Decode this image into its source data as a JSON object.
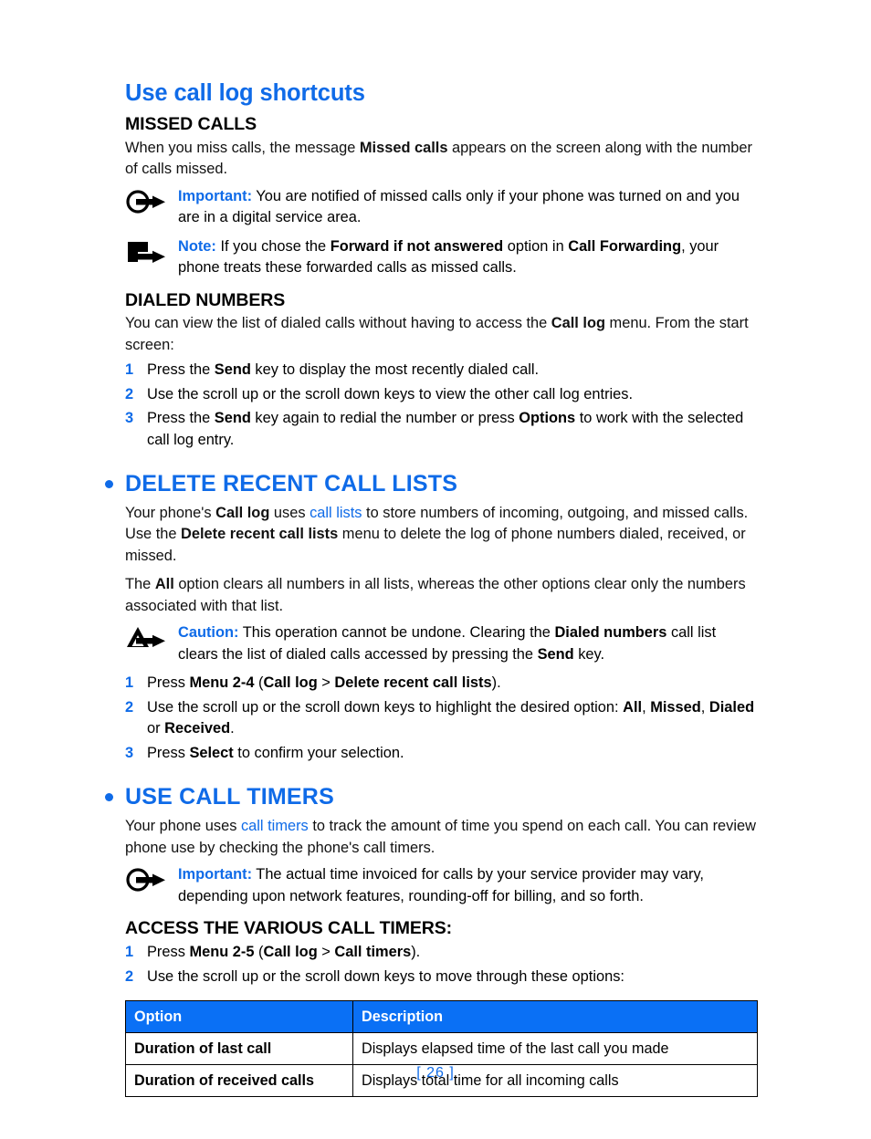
{
  "page": {
    "number_label": "[ 26 ]",
    "accent_color": "#0F6BE8",
    "table_header_color": "#0A70F5"
  },
  "topic": {
    "title": "Use call log shortcuts",
    "missed_calls": {
      "heading": "MISSED CALLS",
      "paragraph_1": "When you miss calls, the message ",
      "paragraph_1_bold": "Missed calls",
      "paragraph_1_end": " appears on the screen along with the number of calls missed.",
      "important": {
        "icon": "important-icon",
        "label": "Important:",
        "text": " You are notified of missed calls only if your phone was turned on and you are in a digital service area."
      },
      "note": {
        "icon": "note-icon",
        "label": "Note:",
        "text_1": " If you chose the ",
        "bold_1": "Forward if not answered",
        "text_2": " option in ",
        "bold_2": "Call Forwarding",
        "text_3": ", your phone treats these forwarded calls as missed calls."
      }
    },
    "dialed_numbers": {
      "heading": "DIALED NUMBERS",
      "intro_1": "You can view the list of dialed calls without having to access the ",
      "intro_bold": "Call log",
      "intro_2": " menu. From the start screen:",
      "steps": [
        {
          "num": "1",
          "text_1": "Press the ",
          "bold_1": "Send",
          "text_2": " key to display the most recently dialed call."
        },
        {
          "num": "2",
          "text_1": "Use the scroll up or the scroll down keys to view the other call log entries.",
          "bold_1": "",
          "text_2": ""
        },
        {
          "num": "3",
          "text_1": "Press the ",
          "bold_1": "Send",
          "text_2": " key again to redial the number or press ",
          "bold_2": "Options",
          "text_3": " to work with the selected call log entry."
        }
      ]
    }
  },
  "delete_recent_call_lists": {
    "title": "DELETE RECENT CALL LISTS",
    "bullet": "section-bullet",
    "p1_a": "Your phone's ",
    "p1_bold_1": "Call log",
    "p1_b": " uses ",
    "p1_blue": "call lists",
    "p1_c": " to store numbers of incoming, outgoing, and missed calls. Use the ",
    "p1_bold_2": "Delete recent call lists",
    "p1_d": " menu to delete the log of phone numbers dialed, received, or missed.",
    "p2_a": "The ",
    "p2_bold": "All",
    "p2_b": " option clears all numbers in all lists, whereas the other options clear only the numbers associated with that list.",
    "caution": {
      "icon": "caution-icon",
      "label": "Caution:",
      "text_1": " This operation cannot be undone. Clearing the ",
      "bold_1": "Dialed numbers",
      "text_2": " call list clears the list of dialed calls accessed by pressing the ",
      "bold_2": "Send",
      "text_3": " key."
    },
    "steps": [
      {
        "num": "1",
        "text_1": "Press ",
        "bold_1": "Menu 2-4",
        "text_2": " (",
        "bold_2": "Call log",
        "text_3": " > ",
        "bold_3": "Delete recent call lists",
        "text_4": ")."
      },
      {
        "num": "2",
        "text_1": "Use the scroll up or the scroll down keys to highlight the desired option: ",
        "bold_1": "All",
        "text_2": ", ",
        "bold_2": "Missed",
        "text_3": ", ",
        "bold_3": "Dialed",
        "text_4": " or ",
        "bold_4": "Received",
        "text_5": "."
      },
      {
        "num": "3",
        "text_1": "Press ",
        "bold_1": "Select",
        "text_2": " to confirm your selection."
      }
    ]
  },
  "use_call_timers": {
    "title": "USE CALL TIMERS",
    "p1_a": "Your phone uses ",
    "p1_blue": "call timers",
    "p1_b": " to track the amount of time you spend on each call. You can review phone use by checking the phone's call timers.",
    "important": {
      "icon": "important-icon",
      "label": "Important:",
      "text": " The actual time invoiced for calls by your service provider may vary, depending upon network features, rounding-off for billing, and so forth."
    },
    "access_heading": "ACCESS THE VARIOUS CALL TIMERS:",
    "steps": [
      {
        "num": "1",
        "text_1": "Press ",
        "bold_1": "Menu 2-5",
        "text_2": " (",
        "bold_2": "Call log",
        "text_3": " > ",
        "bold_3": "Call timers",
        "text_4": ")."
      },
      {
        "num": "2",
        "text_1": "Use the scroll up or the scroll down keys to move through these options:"
      }
    ],
    "table": {
      "headers": [
        "Option",
        "Description"
      ],
      "rows": [
        [
          "Duration of last call",
          "Displays elapsed time of the last call you made"
        ],
        [
          "Duration of received calls",
          "Displays total time for all incoming calls"
        ]
      ]
    }
  }
}
